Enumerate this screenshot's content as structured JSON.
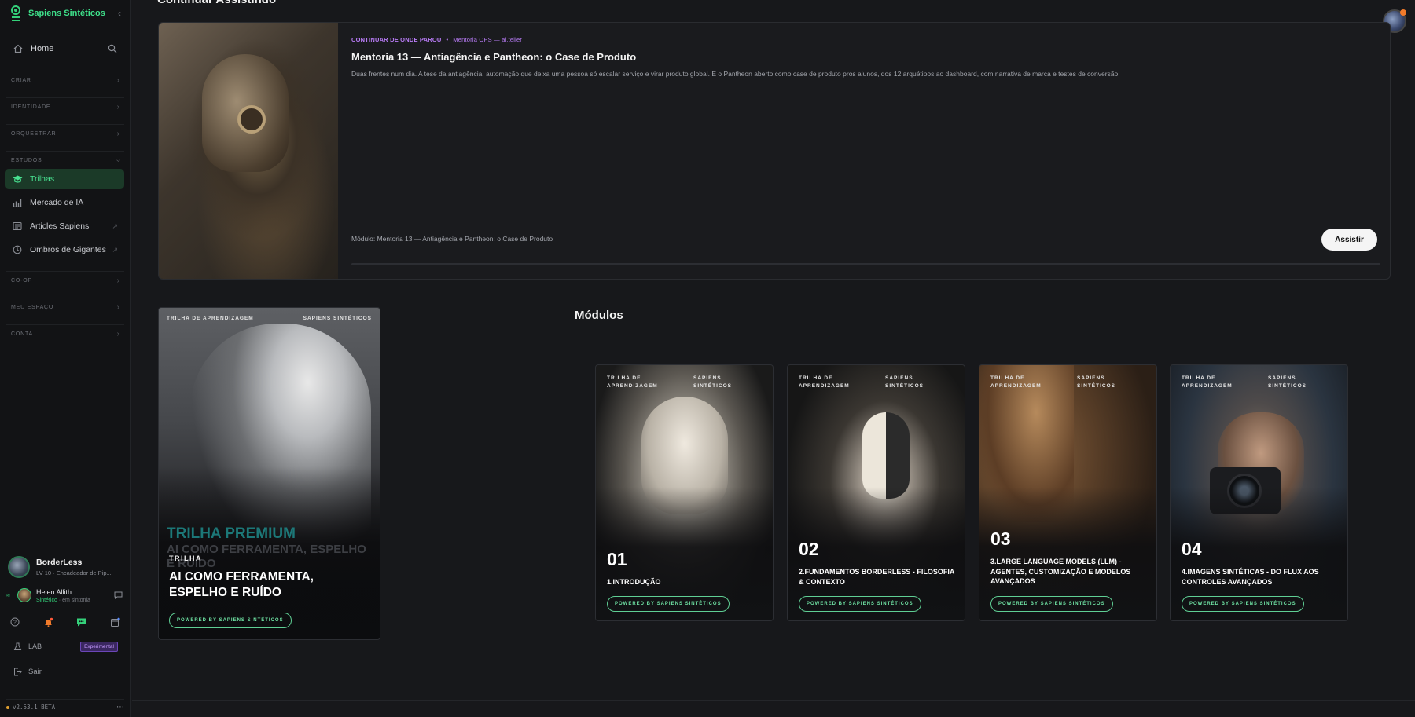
{
  "sidebar": {
    "brand": "Sapiens Sintéticos",
    "home": "Home",
    "sections": {
      "criar": "CRIAR",
      "identidade": "IDENTIDADE",
      "orquestrar": "ORQUESTRAR",
      "estudos": "ESTUDOS",
      "coop": "CO-OP",
      "meu_espaco": "MEU ESPAÇO",
      "conta": "CONTA"
    },
    "items": [
      {
        "label": "Trilhas",
        "icon": "graduation-cap-icon",
        "active": true
      },
      {
        "label": "Mercado de IA",
        "icon": "bar-chart-icon"
      },
      {
        "label": "Articles Sapiens",
        "icon": "newspaper-icon"
      },
      {
        "label": "Ombros de Gigantes",
        "icon": "clock-icon"
      }
    ],
    "user": {
      "name": "BorderLess",
      "level": "LV 10 · Encadeador de Pip..."
    },
    "companion": {
      "name": "Helen Allith",
      "role": "Sintético",
      "status": "em sintonia"
    },
    "lab": {
      "label": "LAB",
      "badge": "Experimental"
    },
    "logout": "Sair",
    "version": "v2.53.1 BETA"
  },
  "continue": {
    "section_title": "Continuar Assistindo",
    "kicker": "CONTINUAR DE ONDE PAROU",
    "separator": "•",
    "source": "Mentoria OPS — ai.telier",
    "title": "Mentoria 13 — Antiagência e Pantheon: o Case de Produto",
    "description": "Duas frentes num dia. A tese da antiagência: automação que deixa uma pessoa só escalar serviço e virar produto global. E o Pantheon aberto como case de produto pros alunos, dos 12 arquétipos ao dashboard, com narrativa de marca e testes de conversão.",
    "module": "Módulo: Mentoria 13 — Antiagência e Pantheon: o Case de Produto",
    "button": "Assistir",
    "progress": 0
  },
  "trail": {
    "top_left": "TRILHA DE APRENDIZAGEM",
    "top_right": "SAPIENS SINTÉTICOS",
    "premium": "TRILHA PREMIUM",
    "ghost_title": "AI COMO FERRAMENTA, ESPELHO E RUÍDO",
    "kind": "TRILHA",
    "title": "AI COMO FERRAMENTA, ESPELHO E RUÍDO",
    "pill": "POWERED BY SAPIENS SINTÉTICOS"
  },
  "modules": {
    "title": "Módulos",
    "items": [
      {
        "tl": "TRILHA DE APRENDIZAGEM",
        "tr": "SAPIENS SINTÉTICOS",
        "num": "01",
        "title": "1.INTRODUÇÃO",
        "pill": "POWERED BY SAPIENS SINTÉTICOS"
      },
      {
        "tl": "TRILHA DE APRENDIZAGEM",
        "tr": "SAPIENS SINTÉTICOS",
        "num": "02",
        "title": "2.FUNDAMENTOS BORDERLESS - FILOSOFIA & CONTEXTO",
        "pill": "POWERED BY SAPIENS SINTÉTICOS"
      },
      {
        "tl": "TRILHA DE APRENDIZAGEM",
        "tr": "SAPIENS SINTÉTICOS",
        "num": "03",
        "title": "3.LARGE LANGUAGE MODELS (LLM) - AGENTES, CUSTOMIZAÇÃO E MODELOS AVANÇADOS",
        "pill": "POWERED BY SAPIENS SINTÉTICOS"
      },
      {
        "tl": "TRILHA DE APRENDIZAGEM",
        "tr": "SAPIENS SINTÉTICOS",
        "num": "04",
        "title": "4.IMAGENS SINTÉTICAS - DO FLUX AOS CONTROLES AVANÇADOS",
        "pill": "POWERED BY SAPIENS SINTÉTICOS"
      }
    ]
  },
  "colors": {
    "accent": "#3ee08a",
    "kicker": "#b97cf7",
    "background": "#17181b",
    "sidebar": "#121315"
  }
}
